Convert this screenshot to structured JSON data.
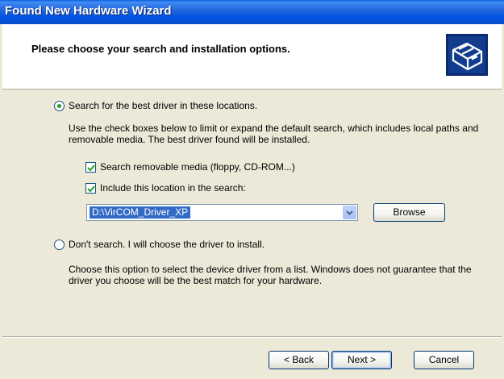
{
  "window": {
    "title": "Found New Hardware Wizard"
  },
  "header": {
    "title": "Please choose your search and installation options.",
    "icon": "hardware-wizard-icon"
  },
  "options": {
    "search_radio_label": "Search for the best driver in these locations.",
    "search_selected": true,
    "search_description": "Use the check boxes below to limit or expand the default search, which includes local paths and removable media. The best driver found will be installed.",
    "removable_media_label": "Search removable media (floppy, CD-ROM...)",
    "removable_media_checked": true,
    "include_location_label": "Include this location in the search:",
    "include_location_checked": true,
    "location_value": "D:\\VirCOM_Driver_XP",
    "browse_label": "Browse",
    "dont_search_label": "Don't search. I will choose the driver to install.",
    "dont_search_selected": false,
    "dont_search_description": "Choose this option to select the device driver from a list.  Windows does not guarantee that the driver you choose will be the best match for your hardware."
  },
  "footer": {
    "back_label": "< Back",
    "next_label": "Next >",
    "cancel_label": "Cancel"
  },
  "colors": {
    "titlebar": "#0054e3",
    "selection": "#316ac5",
    "dialog_bg": "#ece9d8"
  }
}
